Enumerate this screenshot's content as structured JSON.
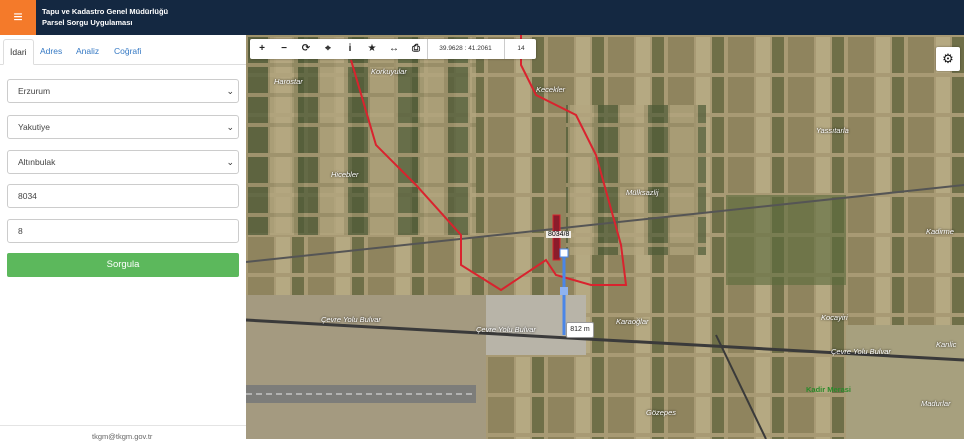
{
  "header": {
    "menu_icon": "hamburger-icon",
    "title_line1": "Tapu ve Kadastro Genel Müdürlüğü",
    "title_line2": "Parsel Sorgu Uygulaması"
  },
  "tabs": [
    {
      "label": "İdari",
      "active": true
    },
    {
      "label": "Adres",
      "active": false
    },
    {
      "label": "Analiz",
      "active": false
    },
    {
      "label": "Coğrafi",
      "active": false
    }
  ],
  "form": {
    "il": "Erzurum",
    "ilce": "Yakutiye",
    "mahalle": "Altınbulak",
    "ada": "8034",
    "parsel": "8",
    "submit_label": "Sorgula"
  },
  "footer": {
    "email": "tkgm@tkgm.gov.tr"
  },
  "map": {
    "toolbar_icons": [
      "zoom-in-icon",
      "zoom-out-icon",
      "refresh-icon",
      "locate-icon",
      "info-icon",
      "star-icon",
      "measure-icon",
      "print-icon"
    ],
    "toolbar_glyphs": [
      "+",
      "−",
      "⟳",
      "⌖",
      "i",
      "★",
      "↔",
      "⎙"
    ],
    "coordinate": "39.9628 : 41.2061",
    "zoom_level": "14",
    "settings_icon": "gear-icon",
    "parcel_label": "8034/8",
    "distance": "812 m",
    "labels": [
      {
        "name": "Harostar",
        "text": "Harostar"
      },
      {
        "name": "Korkuyular",
        "text": "Korkuyular"
      },
      {
        "name": "Kecekler",
        "text": "Kecekler"
      },
      {
        "name": "Hicebler",
        "text": "Hicebler"
      },
      {
        "name": "Mulksazlij",
        "text": "Mülksazlij"
      },
      {
        "name": "Yassitarla",
        "text": "Yassıtarla"
      },
      {
        "name": "Kadirmevzii",
        "text": "Kadirme"
      },
      {
        "name": "Cevre-Yolu-1",
        "text": "Çevre Yolu Bulvar"
      },
      {
        "name": "Cevre-Yolu-2",
        "text": "Çevre Yolu Bulvar"
      },
      {
        "name": "Cevre-Yolu-3",
        "text": "Çevre Yolu Bulvar"
      },
      {
        "name": "Karaoglar",
        "text": "Karaoğlar"
      },
      {
        "name": "Kocayiri",
        "text": "Kocayiri"
      },
      {
        "name": "Gozepes",
        "text": "Gözepes"
      },
      {
        "name": "Kadirlar",
        "text": "Madurlar"
      },
      {
        "name": "Kanlic",
        "text": "Kanlic"
      }
    ],
    "kadir_label": "Kadir Merasi",
    "parcel_outline_color": "#d9232e",
    "measure_line_color": "#4a86e8"
  }
}
